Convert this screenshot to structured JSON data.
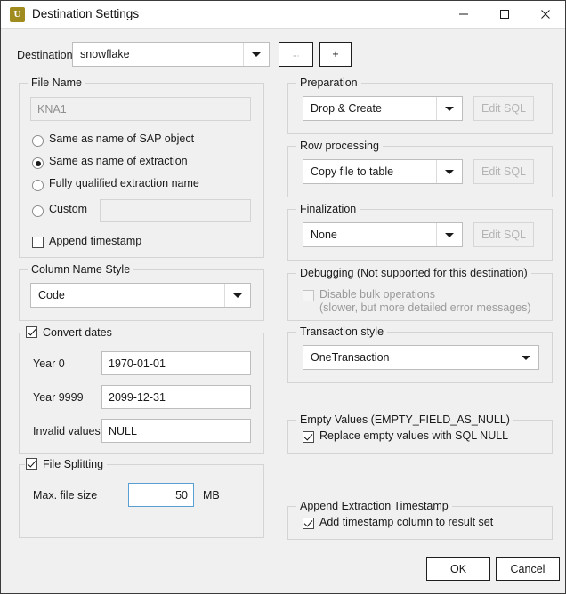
{
  "window": {
    "title": "Destination Settings",
    "app_icon_letter": "U",
    "app_icon_color": "#a08b1e",
    "controls": {
      "minimize": "minimize-icon",
      "maximize": "maximize-icon",
      "close": "close-icon"
    }
  },
  "destination": {
    "label": "Destination",
    "value": "snowflake",
    "browse_button": "...",
    "add_button": "+"
  },
  "file_name": {
    "group_title": "File Name",
    "name_value": "KNA1",
    "options": [
      {
        "label": "Same as name of SAP object",
        "selected": false
      },
      {
        "label": "Same as name of extraction",
        "selected": true
      },
      {
        "label": "Fully qualified extraction name",
        "selected": false
      },
      {
        "label": "Custom",
        "selected": false
      }
    ],
    "custom_value": "",
    "append_timestamp": {
      "label": "Append timestamp",
      "checked": false
    }
  },
  "column_name_style": {
    "group_title": "Column Name Style",
    "value": "Code"
  },
  "convert_dates": {
    "group_title": "Convert dates",
    "checked": true,
    "fields": [
      {
        "label": "Year 0",
        "value": "1970-01-01"
      },
      {
        "label": "Year 9999",
        "value": "2099-12-31"
      },
      {
        "label": "Invalid values",
        "value": "NULL"
      }
    ]
  },
  "file_splitting": {
    "group_title": "File Splitting",
    "checked": true,
    "max_size_label": "Max. file size",
    "max_size_value": "50",
    "unit": "MB"
  },
  "preparation": {
    "group_title": "Preparation",
    "value": "Drop & Create",
    "edit_sql_label": "Edit SQL",
    "edit_sql_enabled": false
  },
  "row_processing": {
    "group_title": "Row processing",
    "value": "Copy file to table",
    "edit_sql_label": "Edit SQL",
    "edit_sql_enabled": false
  },
  "finalization": {
    "group_title": "Finalization",
    "value": "None",
    "edit_sql_label": "Edit SQL",
    "edit_sql_enabled": false
  },
  "debugging": {
    "group_title": "Debugging (Not supported for this destination)",
    "checkbox_label": "Disable bulk operations",
    "checkbox_note": "(slower, but more detailed error messages)",
    "checked": false,
    "enabled": false
  },
  "transaction_style": {
    "group_title": "Transaction style",
    "value": "OneTransaction"
  },
  "empty_values": {
    "group_title": "Empty Values (EMPTY_FIELD_AS_NULL)",
    "checkbox_label": "Replace empty values with SQL NULL",
    "checked": true
  },
  "append_extraction_timestamp": {
    "group_title": "Append Extraction Timestamp",
    "checkbox_label": "Add timestamp column to result set",
    "checked": true
  },
  "footer": {
    "ok_label": "OK",
    "cancel_label": "Cancel"
  }
}
